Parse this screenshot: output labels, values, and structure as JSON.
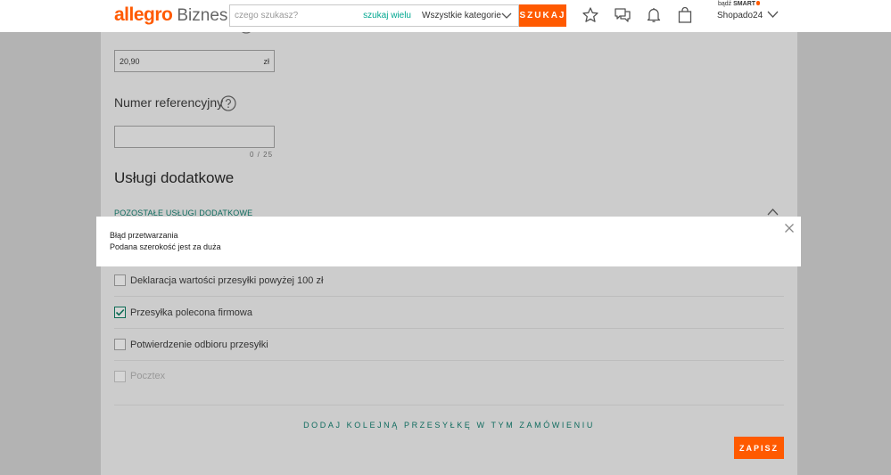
{
  "header": {
    "logo_brand": "allegro",
    "logo_suffix": "Biznes",
    "search_placeholder": "czego szukasz?",
    "search_many_label": "szukaj wielu",
    "category_selected": "Wszystkie kategorie",
    "search_button": "SZUKAJ",
    "smart_prefix": "bądź",
    "smart_brand": "SMART",
    "user_name": "Shopado24",
    "icons": [
      "star-icon",
      "chat-icon",
      "bell-icon",
      "cart-bag-icon",
      "chevron-down-icon"
    ]
  },
  "form": {
    "price_value": "20,90",
    "price_currency": "zł",
    "reference_title": "Numer referencyjny",
    "reference_value": "",
    "reference_counter": "0 / 25",
    "services_title": "Usługi dodatkowe",
    "other_services_label": "POZOSTAŁE USŁUGI DODATKOWE",
    "options": [
      {
        "label": "Deklaracja wartości przesyłki powyżej 100 zł",
        "checked": false,
        "disabled": false
      },
      {
        "label": "Przesyłka polecona firmowa",
        "checked": true,
        "disabled": false
      },
      {
        "label": "Potwierdzenie odbioru przesyłki",
        "checked": false,
        "disabled": false
      },
      {
        "label": "Pocztex",
        "checked": false,
        "disabled": true
      }
    ],
    "add_shipment_link": "DODAJ KOLEJNĄ PRZESYŁKĘ W TYM ZAMÓWIENIU",
    "save_button": "ZAPISZ"
  },
  "dialog": {
    "title": "Błąd przetwarzania",
    "message": "Podana szerokość jest za duża"
  },
  "colors": {
    "brand": "#ff5a00",
    "accent_link": "#0f6b5e",
    "overlay": "#b3b3b3"
  }
}
